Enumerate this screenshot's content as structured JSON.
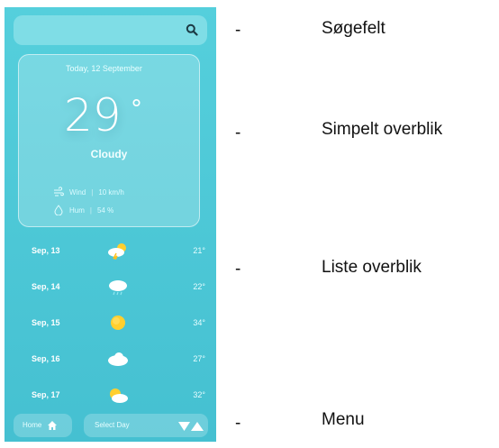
{
  "app": {
    "search": {
      "icon": "search-icon"
    },
    "current": {
      "date": "Today, 12 September",
      "temperature": "29",
      "degree_symbol": "°",
      "condition": "Cloudy",
      "wind": {
        "icon": "wind-icon",
        "label": "Wind",
        "value": "10 km/h"
      },
      "humidity": {
        "icon": "droplet-icon",
        "label": "Hum",
        "value": "54 %"
      }
    },
    "forecast": [
      {
        "date": "Sep, 13",
        "icon": "thunderstorm-icon",
        "temp": "21°"
      },
      {
        "date": "Sep, 14",
        "icon": "rain-cloud-icon",
        "temp": "22°"
      },
      {
        "date": "Sep, 15",
        "icon": "sun-icon",
        "temp": "34°"
      },
      {
        "date": "Sep, 16",
        "icon": "cloud-icon",
        "temp": "27°"
      },
      {
        "date": "Sep, 17",
        "icon": "partly-cloudy-icon",
        "temp": "32°"
      }
    ],
    "menu": {
      "home_label": "Home",
      "select_label": "Select Day"
    }
  },
  "annotations": {
    "dash": "-",
    "items": [
      "Søgefelt",
      "Simpelt overblik",
      "Liste overblik",
      "Menu"
    ]
  },
  "colors": {
    "background": "#4cc7d6",
    "search_bg": "#7fdde6",
    "text": "#ffffff"
  }
}
